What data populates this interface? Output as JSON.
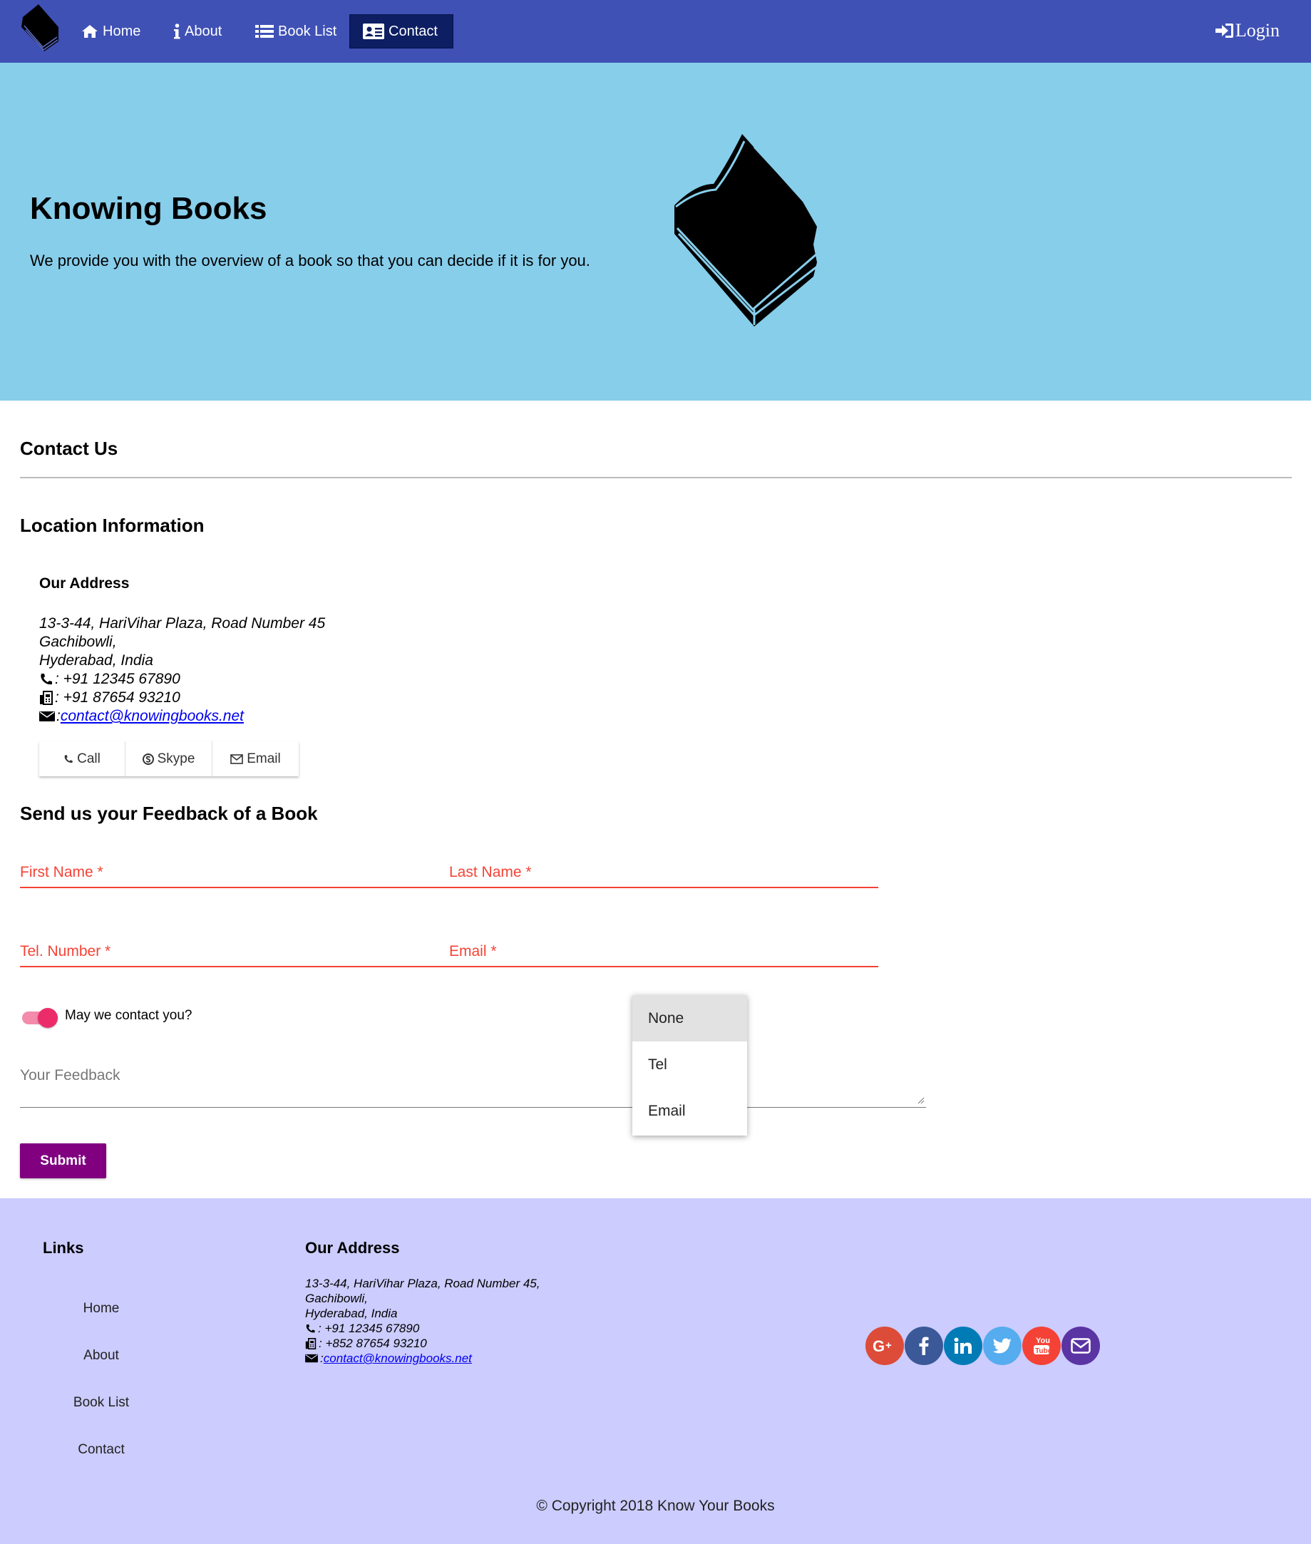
{
  "nav": {
    "items": [
      {
        "label": "Home",
        "icon": "home-icon"
      },
      {
        "label": "About",
        "icon": "info-icon"
      },
      {
        "label": "Book List",
        "icon": "list-icon"
      },
      {
        "label": "Contact",
        "icon": "address-card-icon",
        "active": true
      }
    ],
    "login_label": "Login",
    "background": "#3f51b5",
    "active_background": "#0d1e63"
  },
  "jumbotron": {
    "title": "Knowing Books",
    "subtitle": "We provide you with the overview of a book so that you can decide if it is for you.",
    "background": "#87ceeb"
  },
  "contact": {
    "heading": "Contact Us",
    "location_heading": "Location Information",
    "address_heading": "Our Address",
    "address_lines": [
      "13-3-44, HariVihar Plaza, Road Number 45",
      "Gachibowli,",
      "Hyderabad, India"
    ],
    "phone": ": +91 12345 67890",
    "fax": ": +91 87654 93210",
    "email_prefix": ": ",
    "email": "contact@knowingbooks.net",
    "buttons": {
      "call": "Call",
      "skype": "Skype",
      "email": "Email"
    }
  },
  "feedback_form": {
    "heading": "Send us your Feedback of a Book",
    "first_name": "First Name *",
    "last_name": "Last Name *",
    "tel": "Tel. Number *",
    "email": "Email *",
    "toggle_label": "May we contact you?",
    "toggle_on": true,
    "feedback_placeholder": "Your Feedback",
    "contact_options": [
      "None",
      "Tel",
      "Email"
    ],
    "selected_option": "None",
    "submit_label": "Submit",
    "error_color": "#f44336",
    "submit_color": "#800080"
  },
  "footer": {
    "links_heading": "Links",
    "links": [
      "Home",
      "About",
      "Book List",
      "Contact"
    ],
    "address_heading": "Our Address",
    "address_lines": [
      "13-3-44, HariVihar Plaza, Road Number 45,",
      "Gachibowli,",
      "Hyderabad, India"
    ],
    "phone": ": +91 12345 67890",
    "fax": ": +852 87654 93210",
    "email_prefix": ": ",
    "email": "contact@knowingbooks.net",
    "social": [
      {
        "name": "google-plus-icon",
        "color": "#dd4b39"
      },
      {
        "name": "facebook-icon",
        "color": "#3b5998"
      },
      {
        "name": "linkedin-icon",
        "color": "#007bb6"
      },
      {
        "name": "twitter-icon",
        "color": "#55acee"
      },
      {
        "name": "youtube-icon",
        "color": "#f44336"
      },
      {
        "name": "mail-icon",
        "color": "#5a34a3"
      }
    ],
    "copyright": "© Copyright 2018 Know Your Books",
    "background": "#ccccfe"
  }
}
